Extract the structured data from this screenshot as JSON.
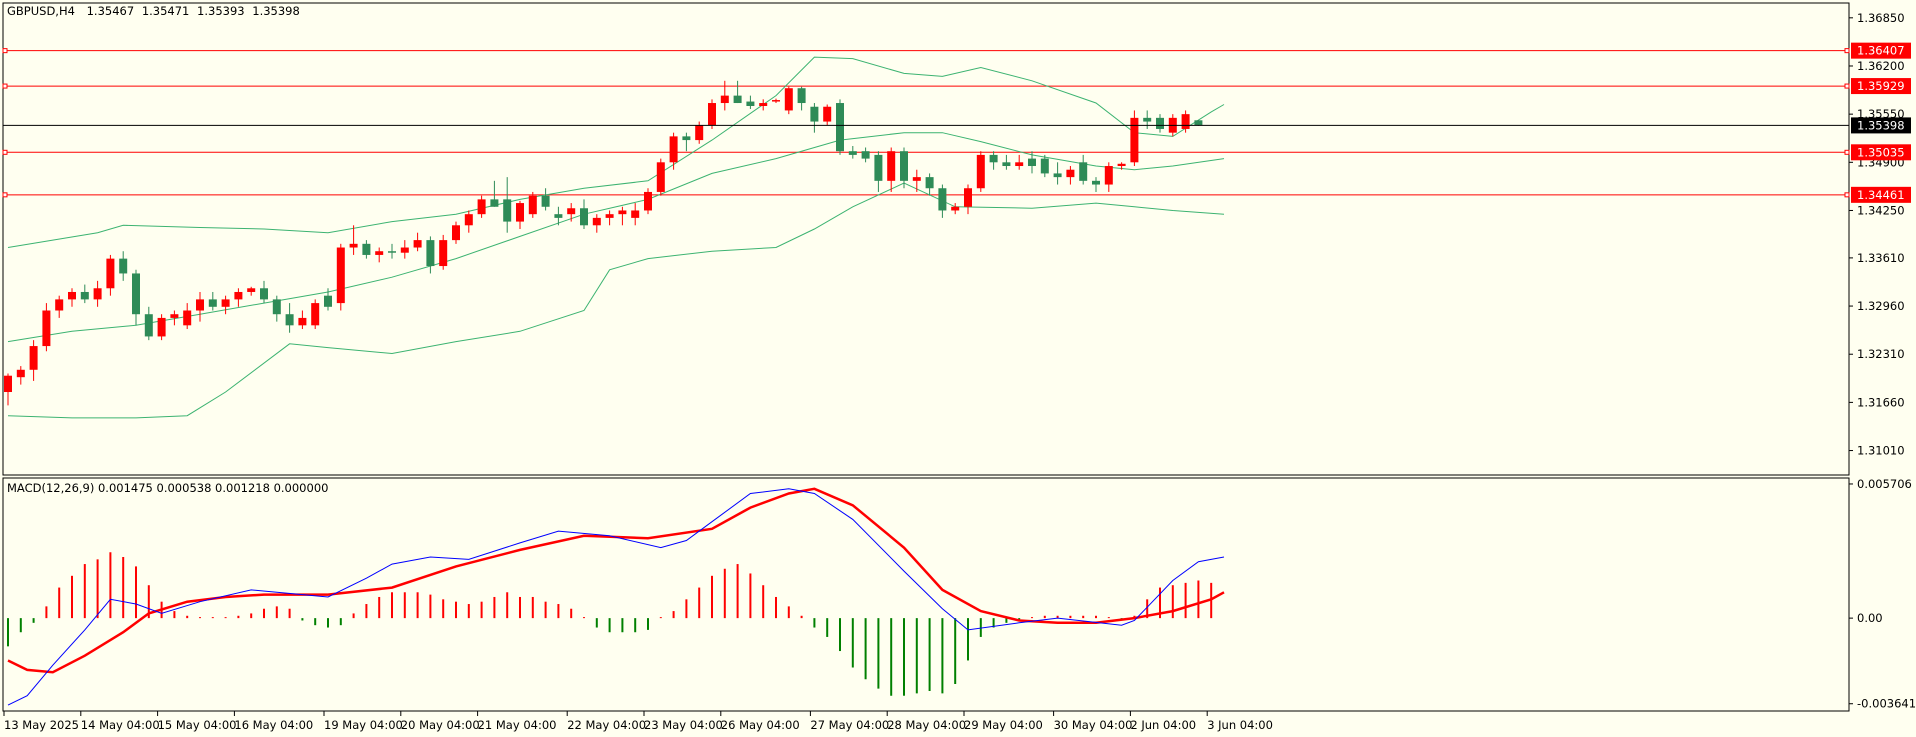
{
  "chart_data": {
    "type": "candlestick",
    "price_panel": {
      "info": {
        "symbol": "GBPUSD,H4",
        "open": "1.35467",
        "high": "1.35471",
        "low": "1.35393",
        "close": "1.35398"
      },
      "ylim": [
        1.3068,
        1.3705
      ],
      "y_ticks": [
        "1.36850",
        "1.36200",
        "1.35550",
        "1.34900",
        "1.34250",
        "1.33610",
        "1.32960",
        "1.32310",
        "1.31660",
        "1.31010"
      ],
      "current_price": {
        "label": "1.35398",
        "value": 1.35398
      },
      "horizontal_lines": [
        {
          "label": "1.36407",
          "value": 1.36407
        },
        {
          "label": "1.35929",
          "value": 1.35929
        },
        {
          "label": "1.35035",
          "value": 1.35035
        },
        {
          "label": "1.34461",
          "value": 1.34461
        }
      ],
      "candles": [
        [
          1.318,
          1.3205,
          1.3162,
          1.3202
        ],
        [
          1.32,
          1.3215,
          1.319,
          1.321
        ],
        [
          1.321,
          1.325,
          1.3195,
          1.3242
        ],
        [
          1.3242,
          1.33,
          1.3235,
          1.329
        ],
        [
          1.329,
          1.331,
          1.328,
          1.3305
        ],
        [
          1.3305,
          1.332,
          1.3295,
          1.3315
        ],
        [
          1.3315,
          1.3325,
          1.33,
          1.3305
        ],
        [
          1.3305,
          1.333,
          1.3295,
          1.332
        ],
        [
          1.332,
          1.3365,
          1.331,
          1.336
        ],
        [
          1.336,
          1.337,
          1.333,
          1.334
        ],
        [
          1.334,
          1.3345,
          1.327,
          1.3285
        ],
        [
          1.3285,
          1.3295,
          1.325,
          1.3255
        ],
        [
          1.3255,
          1.3285,
          1.325,
          1.328
        ],
        [
          1.328,
          1.329,
          1.327,
          1.3285
        ],
        [
          1.327,
          1.33,
          1.3265,
          1.329
        ],
        [
          1.329,
          1.3315,
          1.3275,
          1.3305
        ],
        [
          1.3305,
          1.3315,
          1.329,
          1.3295
        ],
        [
          1.3295,
          1.331,
          1.3285,
          1.3305
        ],
        [
          1.3305,
          1.332,
          1.3295,
          1.3315
        ],
        [
          1.3315,
          1.3322,
          1.331,
          1.332
        ],
        [
          1.332,
          1.333,
          1.33,
          1.3305
        ],
        [
          1.3305,
          1.331,
          1.3275,
          1.3285
        ],
        [
          1.3285,
          1.33,
          1.326,
          1.327
        ],
        [
          1.327,
          1.329,
          1.3265,
          1.328
        ],
        [
          1.327,
          1.3305,
          1.3265,
          1.33
        ],
        [
          1.331,
          1.332,
          1.329,
          1.3295
        ],
        [
          1.33,
          1.338,
          1.329,
          1.3375
        ],
        [
          1.3375,
          1.3405,
          1.3365,
          1.338
        ],
        [
          1.338,
          1.3385,
          1.336,
          1.3365
        ],
        [
          1.3365,
          1.3375,
          1.3355,
          1.337
        ],
        [
          1.337,
          1.338,
          1.336,
          1.3368
        ],
        [
          1.3368,
          1.3385,
          1.336,
          1.3375
        ],
        [
          1.3375,
          1.3395,
          1.337,
          1.3385
        ],
        [
          1.3385,
          1.339,
          1.334,
          1.335
        ],
        [
          1.335,
          1.3392,
          1.3345,
          1.3385
        ],
        [
          1.3385,
          1.341,
          1.338,
          1.3405
        ],
        [
          1.3405,
          1.3425,
          1.3395,
          1.342
        ],
        [
          1.342,
          1.3445,
          1.3415,
          1.344
        ],
        [
          1.344,
          1.3465,
          1.343,
          1.343
        ],
        [
          1.344,
          1.347,
          1.3395,
          1.341
        ],
        [
          1.341,
          1.3438,
          1.34,
          1.3435
        ],
        [
          1.342,
          1.345,
          1.3415,
          1.3445
        ],
        [
          1.3445,
          1.3455,
          1.3425,
          1.343
        ],
        [
          1.342,
          1.343,
          1.3405,
          1.3415
        ],
        [
          1.342,
          1.3435,
          1.341,
          1.3428
        ],
        [
          1.3428,
          1.344,
          1.34,
          1.3405
        ],
        [
          1.3405,
          1.342,
          1.3395,
          1.3415
        ],
        [
          1.3415,
          1.3425,
          1.3405,
          1.342
        ],
        [
          1.342,
          1.343,
          1.3405,
          1.3425
        ],
        [
          1.3415,
          1.3435,
          1.3405,
          1.3425
        ],
        [
          1.3425,
          1.3455,
          1.342,
          1.345
        ],
        [
          1.345,
          1.3495,
          1.3445,
          1.349
        ],
        [
          1.349,
          1.353,
          1.348,
          1.3525
        ],
        [
          1.3525,
          1.353,
          1.3505,
          1.352
        ],
        [
          1.352,
          1.3545,
          1.3515,
          1.354
        ],
        [
          1.354,
          1.3575,
          1.3535,
          1.357
        ],
        [
          1.357,
          1.36,
          1.356,
          1.358
        ],
        [
          1.358,
          1.36,
          1.357,
          1.357
        ],
        [
          1.3572,
          1.358,
          1.3562,
          1.3566
        ],
        [
          1.3566,
          1.3575,
          1.356,
          1.357
        ],
        [
          1.3572,
          1.3576,
          1.357,
          1.3574
        ],
        [
          1.356,
          1.3592,
          1.3555,
          1.359
        ],
        [
          1.359,
          1.3592,
          1.356,
          1.357
        ],
        [
          1.3565,
          1.357,
          1.353,
          1.3545
        ],
        [
          1.3545,
          1.3568,
          1.354,
          1.3565
        ],
        [
          1.357,
          1.3575,
          1.35,
          1.3505
        ],
        [
          1.3505,
          1.3512,
          1.3495,
          1.35
        ],
        [
          1.3505,
          1.351,
          1.349,
          1.3495
        ],
        [
          1.35,
          1.3505,
          1.345,
          1.3465
        ],
        [
          1.3465,
          1.351,
          1.345,
          1.3505
        ],
        [
          1.3505,
          1.351,
          1.3455,
          1.3465
        ],
        [
          1.3465,
          1.348,
          1.345,
          1.347
        ],
        [
          1.347,
          1.3475,
          1.3445,
          1.3455
        ],
        [
          1.3455,
          1.346,
          1.3415,
          1.3425
        ],
        [
          1.3425,
          1.3435,
          1.342,
          1.343
        ],
        [
          1.343,
          1.346,
          1.342,
          1.3455
        ],
        [
          1.3455,
          1.3505,
          1.345,
          1.35
        ],
        [
          1.35,
          1.3505,
          1.348,
          1.349
        ],
        [
          1.349,
          1.35,
          1.348,
          1.3485
        ],
        [
          1.3485,
          1.35,
          1.348,
          1.349
        ],
        [
          1.3495,
          1.3505,
          1.3475,
          1.3485
        ],
        [
          1.3495,
          1.35,
          1.347,
          1.3475
        ],
        [
          1.3475,
          1.349,
          1.346,
          1.347
        ],
        [
          1.347,
          1.3485,
          1.346,
          1.348
        ],
        [
          1.349,
          1.35,
          1.346,
          1.3465
        ],
        [
          1.3465,
          1.347,
          1.345,
          1.346
        ],
        [
          1.346,
          1.349,
          1.345,
          1.3485
        ],
        [
          1.3485,
          1.349,
          1.348,
          1.3488
        ],
        [
          1.349,
          1.356,
          1.3485,
          1.355
        ],
        [
          1.355,
          1.356,
          1.3535,
          1.3545
        ],
        [
          1.355,
          1.3555,
          1.353,
          1.3535
        ],
        [
          1.353,
          1.3555,
          1.3525,
          1.355
        ],
        [
          1.3535,
          1.356,
          1.353,
          1.3555
        ],
        [
          1.35467,
          1.35471,
          1.35393,
          1.35398
        ]
      ],
      "bollinger_upper": [
        [
          0,
          1.3375
        ],
        [
          7,
          1.3395
        ],
        [
          9,
          1.3405
        ],
        [
          15,
          1.3402
        ],
        [
          20,
          1.34
        ],
        [
          25,
          1.3395
        ],
        [
          30,
          1.341
        ],
        [
          35,
          1.342
        ],
        [
          40,
          1.344
        ],
        [
          45,
          1.3455
        ],
        [
          50,
          1.3465
        ],
        [
          55,
          1.352
        ],
        [
          60,
          1.358
        ],
        [
          63,
          1.3632
        ],
        [
          66,
          1.363
        ],
        [
          70,
          1.361
        ],
        [
          73,
          1.3606
        ],
        [
          76,
          1.3618
        ],
        [
          80,
          1.36
        ],
        [
          85,
          1.357
        ],
        [
          88,
          1.353
        ],
        [
          91,
          1.3525
        ],
        [
          94,
          1.3558
        ],
        [
          95,
          1.3568
        ]
      ],
      "bollinger_middle": [
        [
          0,
          1.3248
        ],
        [
          5,
          1.3262
        ],
        [
          10,
          1.327
        ],
        [
          15,
          1.3285
        ],
        [
          20,
          1.33
        ],
        [
          25,
          1.3315
        ],
        [
          30,
          1.3335
        ],
        [
          35,
          1.336
        ],
        [
          40,
          1.339
        ],
        [
          45,
          1.342
        ],
        [
          50,
          1.344
        ],
        [
          55,
          1.3475
        ],
        [
          60,
          1.3495
        ],
        [
          65,
          1.352
        ],
        [
          70,
          1.353
        ],
        [
          73,
          1.353
        ],
        [
          76,
          1.3518
        ],
        [
          80,
          1.35
        ],
        [
          85,
          1.3485
        ],
        [
          88,
          1.348
        ],
        [
          91,
          1.3485
        ],
        [
          95,
          1.3495
        ]
      ],
      "bollinger_lower": [
        [
          0,
          1.3148
        ],
        [
          5,
          1.3145
        ],
        [
          10,
          1.3145
        ],
        [
          14,
          1.3148
        ],
        [
          17,
          1.318
        ],
        [
          22,
          1.3245
        ],
        [
          25,
          1.324
        ],
        [
          30,
          1.3232
        ],
        [
          35,
          1.3248
        ],
        [
          40,
          1.3262
        ],
        [
          45,
          1.329
        ],
        [
          47,
          1.3345
        ],
        [
          50,
          1.336
        ],
        [
          55,
          1.337
        ],
        [
          60,
          1.3375
        ],
        [
          63,
          1.34
        ],
        [
          66,
          1.343
        ],
        [
          70,
          1.3462
        ],
        [
          74,
          1.343
        ],
        [
          80,
          1.3428
        ],
        [
          85,
          1.3435
        ],
        [
          88,
          1.343
        ],
        [
          91,
          1.3425
        ],
        [
          95,
          1.342
        ]
      ]
    },
    "macd_panel": {
      "label": "MACD(12,26,9) 0.001475 0.000538 0.001218 0.000000",
      "ylim": [
        -0.00395,
        0.00596
      ],
      "y_ticks": [
        "0.005706",
        "0.00",
        "-0.003641"
      ],
      "histogram": [
        -0.0012,
        -0.0006,
        -0.0002,
        0.0005,
        0.0013,
        0.0018,
        0.0023,
        0.0025,
        0.0028,
        0.0026,
        0.0022,
        0.0014,
        0.0007,
        0.0003,
        0.0001,
        0.0,
        0.0,
        0.0,
        0.0001,
        0.0002,
        0.0004,
        0.0005,
        0.0004,
        -0.0001,
        -0.0003,
        -0.0004,
        -0.0003,
        0.0002,
        0.0006,
        0.0009,
        0.0011,
        0.0011,
        0.0011,
        0.001,
        0.0008,
        0.0007,
        0.0006,
        0.0007,
        0.0009,
        0.0011,
        0.0009,
        0.0009,
        0.0007,
        0.0006,
        0.0004,
        0.0,
        -0.0004,
        -0.0006,
        -0.0006,
        -0.0006,
        -0.0005,
        0.0,
        0.0003,
        0.0008,
        0.0013,
        0.0018,
        0.0021,
        0.0023,
        0.0019,
        0.0014,
        0.0009,
        0.0005,
        0.0001,
        -0.0004,
        -0.0008,
        -0.0014,
        -0.0021,
        -0.0026,
        -0.003,
        -0.0033,
        -0.0033,
        -0.0032,
        -0.0031,
        -0.0032,
        -0.0028,
        -0.0018,
        -0.0008,
        -0.0004,
        -0.0002,
        -0.0001,
        0.0,
        0.0001,
        0.0001,
        0.0001,
        0.0001,
        0.0001,
        0.0,
        -0.0001,
        0.0001,
        0.0008,
        0.0013,
        0.0014,
        0.0015,
        0.0016,
        0.0015
      ],
      "signal_line": [
        [
          0,
          -0.0018
        ],
        [
          1.5,
          -0.0022
        ],
        [
          3.5,
          -0.0023
        ],
        [
          6,
          -0.0016
        ],
        [
          9,
          -0.0006
        ],
        [
          11,
          0.0002
        ],
        [
          14,
          0.0007
        ],
        [
          17,
          0.0009
        ],
        [
          20,
          0.001
        ],
        [
          25,
          0.001
        ],
        [
          30,
          0.0013
        ],
        [
          35,
          0.0022
        ],
        [
          40,
          0.0029
        ],
        [
          45,
          0.0035
        ],
        [
          50,
          0.0034
        ],
        [
          55,
          0.0038
        ],
        [
          58,
          0.0047
        ],
        [
          61,
          0.0053
        ],
        [
          63,
          0.0055
        ],
        [
          66,
          0.0048
        ],
        [
          70,
          0.003
        ],
        [
          73,
          0.0012
        ],
        [
          76,
          0.0003
        ],
        [
          79,
          -0.0001
        ],
        [
          82,
          -0.0002
        ],
        [
          85,
          -0.0002
        ],
        [
          88,
          0.0
        ],
        [
          91,
          0.0003
        ],
        [
          94,
          0.0008
        ],
        [
          95,
          0.0011
        ]
      ],
      "macd_line": [
        [
          0,
          -0.0037
        ],
        [
          1.5,
          -0.0033
        ],
        [
          3.5,
          -0.002
        ],
        [
          6,
          -0.0005
        ],
        [
          8,
          0.0008
        ],
        [
          10,
          0.0006
        ],
        [
          12,
          0.0002
        ],
        [
          15,
          0.0007
        ],
        [
          19,
          0.0012
        ],
        [
          25,
          0.0009
        ],
        [
          28,
          0.0017
        ],
        [
          30,
          0.0023
        ],
        [
          33,
          0.0026
        ],
        [
          36,
          0.0025
        ],
        [
          40,
          0.0032
        ],
        [
          43,
          0.0037
        ],
        [
          47,
          0.0035
        ],
        [
          51,
          0.003
        ],
        [
          53,
          0.0033
        ],
        [
          55,
          0.0041
        ],
        [
          58,
          0.0053
        ],
        [
          61,
          0.0055
        ],
        [
          63,
          0.0053
        ],
        [
          66,
          0.0042
        ],
        [
          70,
          0.002
        ],
        [
          73,
          0.0004
        ],
        [
          75,
          -0.0005
        ],
        [
          79,
          -0.0002
        ],
        [
          82,
          0.0
        ],
        [
          87,
          -0.0003
        ],
        [
          88,
          -0.0001
        ],
        [
          91,
          0.0016
        ],
        [
          93,
          0.0024
        ],
        [
          95,
          0.0026
        ]
      ]
    },
    "x_labels": [
      {
        "index": 0,
        "label": "13 May 2025"
      },
      {
        "index": 6,
        "label": "14 May 04:00"
      },
      {
        "index": 12,
        "label": "15 May 04:00"
      },
      {
        "index": 18,
        "label": "16 May 04:00"
      },
      {
        "index": 25,
        "label": "19 May 04:00"
      },
      {
        "index": 31,
        "label": "20 May 04:00"
      },
      {
        "index": 37,
        "label": "21 May 04:00"
      },
      {
        "index": 44,
        "label": "22 May 04:00"
      },
      {
        "index": 50,
        "label": "23 May 04:00"
      },
      {
        "index": 56,
        "label": "26 May 04:00"
      },
      {
        "index": 63,
        "label": "27 May 04:00"
      },
      {
        "index": 69,
        "label": "28 May 04:00"
      },
      {
        "index": 75,
        "label": "29 May 04:00"
      },
      {
        "index": 82,
        "label": "30 May 04:00"
      },
      {
        "index": 88,
        "label": "2 Jun 04:00"
      },
      {
        "index": 94,
        "label": "3 Jun 04:00"
      }
    ],
    "colors": {
      "background": "#fffff0",
      "bull": "#ff0000",
      "bear": "#2e8b57",
      "bands": "#3cb371",
      "level_line": "#ff0000",
      "current_line": "#000000",
      "hist_pos": "#ff0000",
      "hist_neg": "#008000",
      "macd_line": "#0000ff",
      "signal_line": "#ff0000",
      "axis": "#000000"
    }
  }
}
